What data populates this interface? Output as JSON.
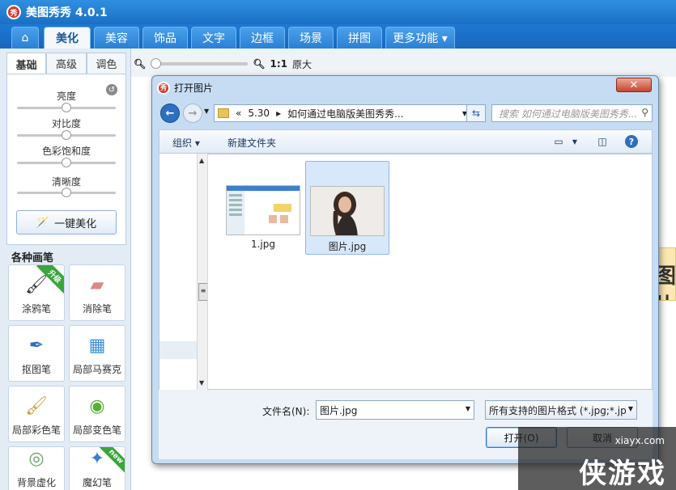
{
  "app": {
    "title": "美图秀秀 4.0.1",
    "logo_text": "秀"
  },
  "main_tabs": [
    {
      "label": "⌂",
      "icon": "home-icon"
    },
    {
      "label": "美化",
      "active": true
    },
    {
      "label": "美容"
    },
    {
      "label": "饰品"
    },
    {
      "label": "文字"
    },
    {
      "label": "边框"
    },
    {
      "label": "场景"
    },
    {
      "label": "拼图"
    },
    {
      "label": "更多功能 ▾"
    }
  ],
  "left_panel": {
    "subtabs": [
      "基础",
      "高级",
      "调色"
    ],
    "sliders": [
      {
        "label": "亮度",
        "value": 0.5
      },
      {
        "label": "对比度",
        "value": 0.5
      },
      {
        "label": "色彩饱和度",
        "value": 0.5
      },
      {
        "label": "清晰度",
        "value": 0.5
      }
    ],
    "one_key_label": "一键美化",
    "brushes_title": "各种画笔",
    "brushes": [
      {
        "label": "涂鸦笔",
        "icon": "paintbrush-icon",
        "badge": "升级"
      },
      {
        "label": "消除笔",
        "icon": "eraser-icon"
      },
      {
        "label": "抠图笔",
        "icon": "pen-cutout-icon"
      },
      {
        "label": "局部马赛克",
        "icon": "mosaic-icon"
      },
      {
        "label": "局部彩色笔",
        "icon": "color-brush-icon"
      },
      {
        "label": "局部变色笔",
        "icon": "color-change-icon"
      },
      {
        "label": "背景虚化",
        "icon": "blur-icon"
      },
      {
        "label": "魔幻笔",
        "icon": "magic-wand-icon",
        "badge": "new"
      }
    ]
  },
  "zoom": {
    "ratio_label": "1:1",
    "original_label": "原大",
    "value": 0.0
  },
  "preview_text": "图片",
  "dialog": {
    "title": "打开图片",
    "close_label": "✕",
    "breadcrumb": [
      "«",
      "5.30",
      "▸",
      "如何通过电脑版美图秀秀..."
    ],
    "search_placeholder": "搜索 如何通过电脑版美图秀秀...",
    "toolbar": {
      "organize": "组织 ▾",
      "new_folder": "新建文件夹"
    },
    "files": [
      {
        "name": "1.jpg",
        "selected": false
      },
      {
        "name": "图片.jpg",
        "selected": true
      }
    ],
    "filename_label": "文件名(N):",
    "filename_value": "图片.jpg",
    "filter_value": "所有支持的图片格式 (*.jpg;*.jp",
    "open_label": "打开(O)",
    "cancel_label": "取消"
  },
  "watermark": {
    "site": "xiayx.com",
    "logo": "侠游戏"
  }
}
